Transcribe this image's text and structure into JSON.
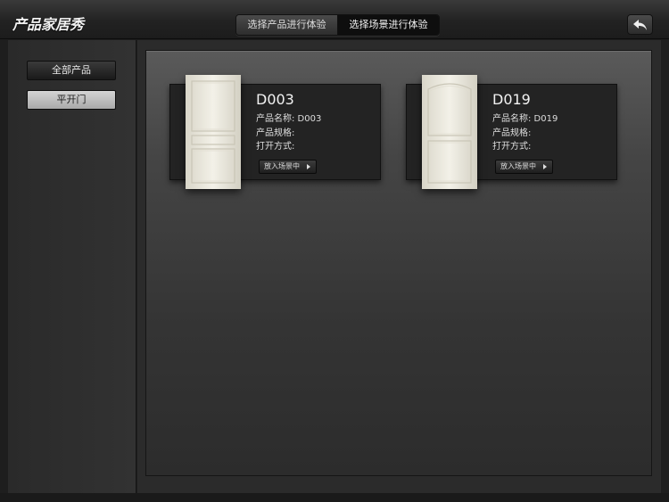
{
  "app": {
    "logo_text": "产品家居秀"
  },
  "header": {
    "tabs": [
      {
        "label": "选择产品进行体验",
        "active": false
      },
      {
        "label": "选择场景进行体验",
        "active": true
      }
    ],
    "back_icon": "back-arrow-icon"
  },
  "sidebar": {
    "items": [
      {
        "label": "全部产品",
        "selected": false
      },
      {
        "label": "平开门",
        "selected": true
      }
    ]
  },
  "products": [
    {
      "code": "D003",
      "name_line": "产品名称: D003",
      "spec_line": "产品规格:",
      "open_line": "打开方式:",
      "action_label": "放入场景中",
      "image": "white-panel-door-flat-top"
    },
    {
      "code": "D019",
      "name_line": "产品名称: D019",
      "spec_line": "产品规格:",
      "open_line": "打开方式:",
      "action_label": "放入场景中",
      "image": "white-panel-door-arched-top"
    }
  ],
  "colors": {
    "active_tab": "#0e0e0e",
    "selected_sidebar_item": "#c2c2c2",
    "door_white": "#ece9dd"
  }
}
